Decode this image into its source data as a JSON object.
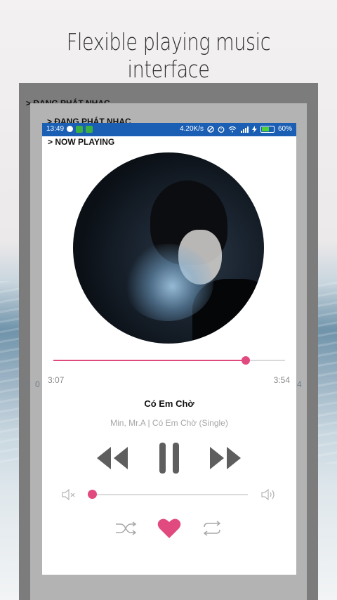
{
  "headline": "Flexible playing music interface",
  "ghost": {
    "label_back": "> ĐANG PHÁT NHẠC",
    "label_mid": "> ĐANG PHÁT NHẠC",
    "time_left_1": "0",
    "time_left_2": "0",
    "time_right": "4"
  },
  "status_bar": {
    "time": "13:49",
    "speed": "4.20K/s",
    "battery": "60%"
  },
  "screen_title": "> NOW PLAYING",
  "player": {
    "elapsed": "3:07",
    "duration": "3:54",
    "progress": 0.83,
    "volume": 0.0,
    "song_title": "Có Em Chờ",
    "song_subtitle": "Min, Mr.A | Có Em Chờ (Single)",
    "liked": true
  },
  "colors": {
    "accent": "#e14a7f",
    "status_bar": "#1a5fb4",
    "controls": "#5e5e5e"
  },
  "icons": [
    "rewind-icon",
    "pause-icon",
    "fast-forward-icon",
    "volume-mute-icon",
    "volume-up-icon",
    "shuffle-icon",
    "heart-icon",
    "repeat-icon"
  ]
}
